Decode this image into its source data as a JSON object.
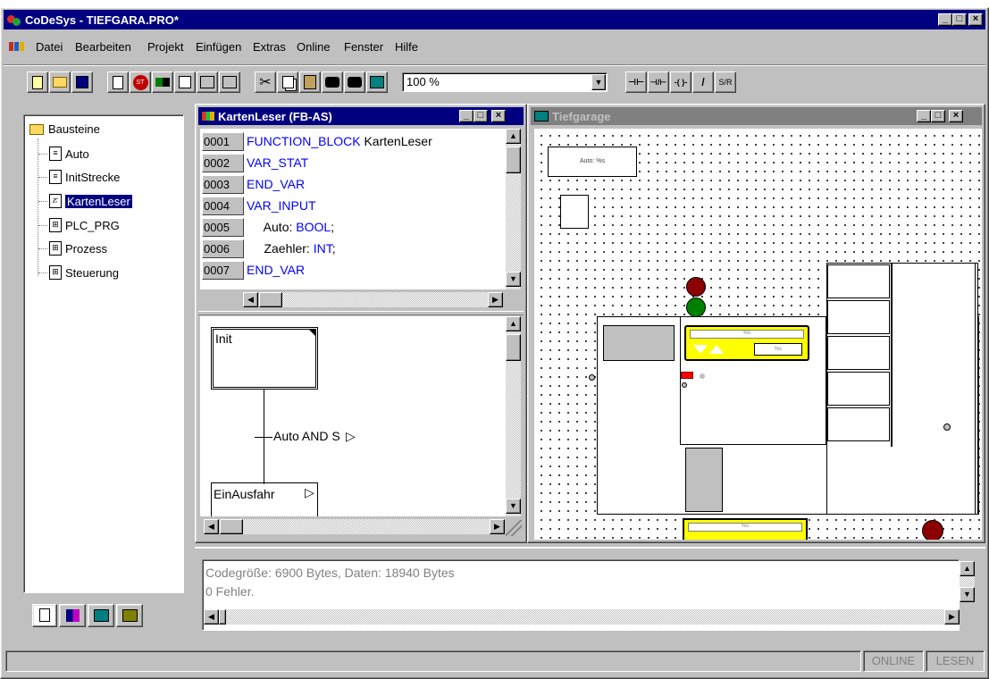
{
  "app": {
    "title": "CoDeSys - TIEFGARA.PRO*",
    "caption_buttons": {
      "minimize": "_",
      "maximize": "□",
      "close": "×"
    }
  },
  "menu": {
    "items": [
      "Datei",
      "Bearbeiten",
      "Projekt",
      "Einfügen",
      "Extras",
      "Online",
      "Fenster",
      "Hilfe"
    ]
  },
  "toolbar": {
    "zoom_value": "100 %",
    "ld_buttons": [
      "⊣⊢",
      "⊣/⊢",
      "-( )-",
      "/",
      "S/R"
    ]
  },
  "tree": {
    "root_label": "Bausteine",
    "items": [
      "Auto",
      "InitStrecke",
      "KartenLeser",
      "PLC_PRG",
      "Prozess",
      "Steuerung"
    ],
    "selected": "KartenLeser"
  },
  "editor": {
    "title": "KartenLeser (FB-AS)",
    "lines": [
      {
        "no": "0001",
        "parts": [
          {
            "t": "FUNCTION_BLOCK",
            "kw": true
          },
          {
            "t": " KartenLeser",
            "kw": false
          }
        ]
      },
      {
        "no": "0002",
        "parts": [
          {
            "t": "VAR_STAT",
            "kw": true
          }
        ]
      },
      {
        "no": "0003",
        "parts": [
          {
            "t": "END_VAR",
            "kw": true
          }
        ]
      },
      {
        "no": "0004",
        "parts": [
          {
            "t": "VAR_INPUT",
            "kw": true
          }
        ]
      },
      {
        "no": "0005",
        "parts": [
          {
            "t": "     Auto: ",
            "kw": false
          },
          {
            "t": "BOOL",
            "kw": true
          },
          {
            "t": ";",
            "kw": false
          }
        ]
      },
      {
        "no": "0006",
        "parts": [
          {
            "t": "     Zaehler: ",
            "kw": false
          },
          {
            "t": "INT",
            "kw": true
          },
          {
            "t": ";",
            "kw": false
          }
        ]
      },
      {
        "no": "0007",
        "parts": [
          {
            "t": "END_VAR",
            "kw": true
          }
        ]
      }
    ],
    "sfc": {
      "init_step": "Init",
      "transition": "Auto AND S",
      "step2": "EinAusfahr"
    }
  },
  "visu": {
    "title": "Tiefgarage",
    "label_auto": "Auto: %s",
    "label_s": "%s"
  },
  "messages": {
    "line1": "Codegröße: 6900 Bytes, Daten: 18940 Bytes",
    "line2": "0 Fehler."
  },
  "status": {
    "online": "ONLINE",
    "lesen": "LESEN"
  },
  "colors": {
    "title_active": "#000080",
    "keyword": "#0000ff",
    "traffic_red": "#8b0000",
    "traffic_green": "#008000",
    "yellow": "#ffff00"
  }
}
